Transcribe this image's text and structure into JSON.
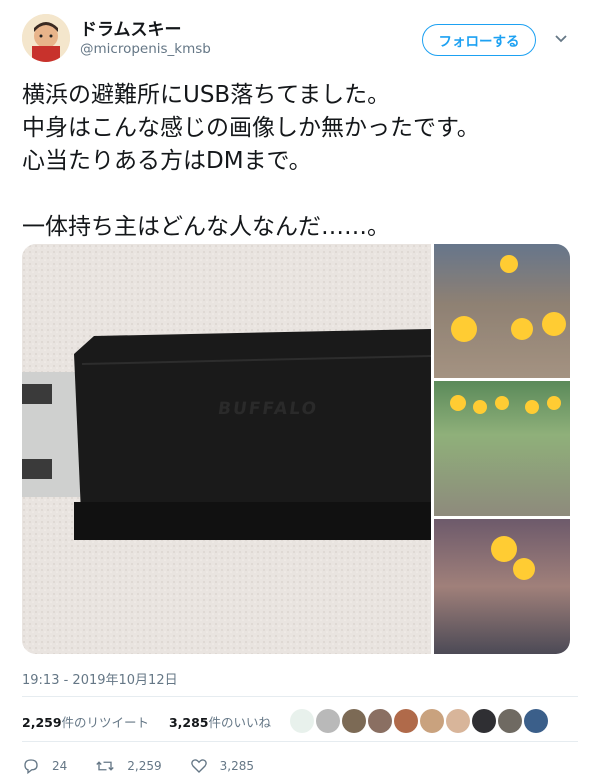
{
  "user": {
    "name": "ドラムスキー",
    "handle": "@micropenis_kmsb"
  },
  "follow_label": "フォローする",
  "tweet": {
    "text": "横浜の避難所にUSB落ちてました。\n中身はこんな感じの画像しか無かったです。\n心当たりある方はDMまで。\n\n一体持ち主はどんな人なんだ……。",
    "timestamp": "19:13 - 2019年10月12日"
  },
  "media": {
    "brand_text": "BUFFALO"
  },
  "stats": {
    "retweets": "2,259",
    "retweets_label": "件のリツイート",
    "likes": "3,285",
    "likes_label": "件のいいね"
  },
  "actions": {
    "replies": "24",
    "retweets": "2,259",
    "likes": "3,285"
  },
  "colors": {
    "accent": "#1da1f2",
    "secondary_text": "#657786",
    "divider": "#e6ecf0"
  }
}
